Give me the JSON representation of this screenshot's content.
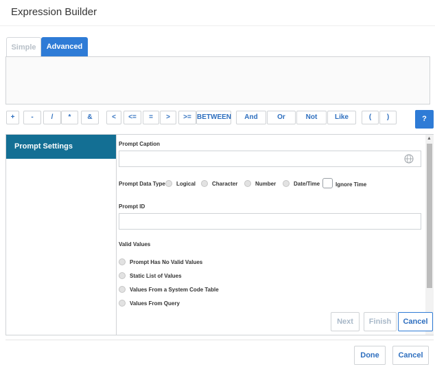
{
  "window": {
    "title": "Expression Builder"
  },
  "tabs": [
    {
      "label": "Simple",
      "active": false
    },
    {
      "label": "Advanced",
      "active": true
    }
  ],
  "operators": [
    "+",
    "-",
    "/",
    "*",
    "&",
    "<",
    "<=",
    "=",
    ">",
    ">=",
    "BETWEEN",
    "And",
    "Or",
    "Not",
    "Like",
    "(",
    ")"
  ],
  "help_label": "?",
  "left_nav": {
    "active_item": "Prompt Settings"
  },
  "prompt": {
    "caption_label": "Prompt Caption",
    "caption_value": "",
    "data_type_label": "Prompt Data Type",
    "data_types": [
      "Logical",
      "Character",
      "Number",
      "Date/Time"
    ],
    "ignore_time_label": "Ignore Time",
    "id_label": "Prompt ID",
    "id_value": "",
    "valid_values_label": "Valid Values",
    "valid_values_options": [
      "Prompt Has No Valid Values",
      "Static List of Values",
      "Values From a System Code Table",
      "Values From Query"
    ]
  },
  "wizard_buttons": {
    "next": "Next",
    "finish": "Finish",
    "cancel": "Cancel"
  },
  "footer_buttons": {
    "done": "Done",
    "cancel": "Cancel"
  },
  "colors": {
    "accent": "#2e7bd6",
    "nav_active": "#136f94",
    "link_text": "#2e6fbf"
  }
}
